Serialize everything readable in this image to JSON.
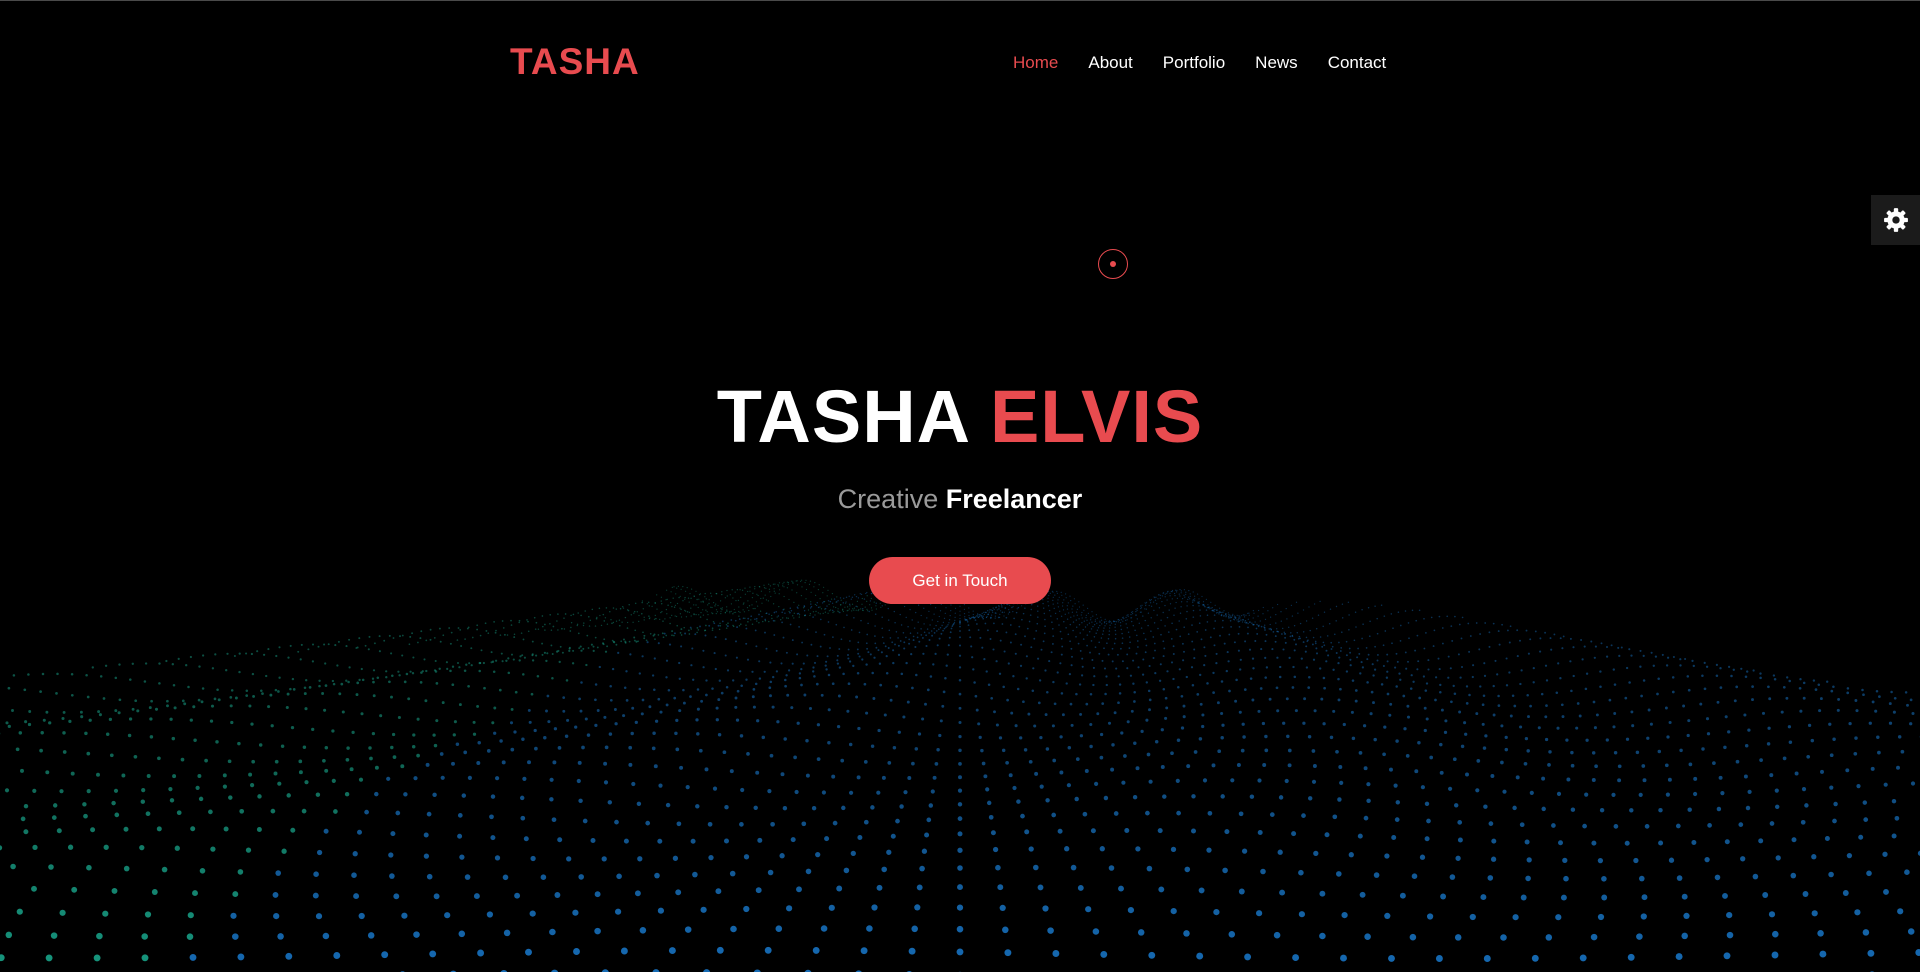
{
  "header": {
    "logo": "TASHA",
    "nav": [
      {
        "label": "Home",
        "active": true
      },
      {
        "label": "About",
        "active": false
      },
      {
        "label": "Portfolio",
        "active": false
      },
      {
        "label": "News",
        "active": false
      },
      {
        "label": "Contact",
        "active": false
      }
    ]
  },
  "settings": {
    "icon": "gear-icon"
  },
  "hero": {
    "first_name": "TASHA",
    "last_name": "ELVIS",
    "subtitle_muted": "Creative",
    "subtitle_bright": "Freelancer",
    "cta_label": "Get in Touch"
  },
  "colors": {
    "accent": "#e84b4f",
    "background": "#000000",
    "particles_teal": "#1bb598",
    "particles_blue": "#1a7fd6"
  }
}
